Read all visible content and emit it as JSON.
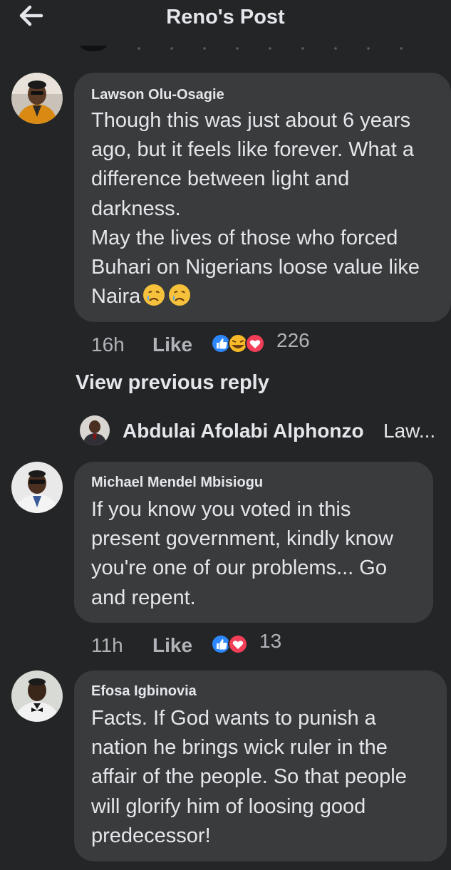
{
  "header": {
    "title": "Reno's Post",
    "back_icon": "arrow-left-icon"
  },
  "comments": [
    {
      "author": "Lawson Olu-Osagie",
      "lines": [
        "Though this was just about 6 years",
        "ago, but it feels like forever. What a",
        "difference between light and",
        "darkness.",
        "May the lives of those who forced",
        "Buhari on Nigerians loose value like",
        "Naira"
      ],
      "emoji": [
        "crying-face",
        "crying-face"
      ],
      "time": "16h",
      "like_label": "Like",
      "reactions": [
        "like",
        "haha",
        "love"
      ],
      "reaction_count": "226"
    },
    {
      "author": "Michael Mendel Mbisiogu",
      "lines": [
        "If you know you voted in this",
        "present government, kindly know",
        "you're one of our problems... Go",
        "and repent."
      ],
      "time": "11h",
      "like_label": "Like",
      "reactions": [
        "like",
        "love"
      ],
      "reaction_count": "13"
    },
    {
      "author": "Efosa Igbinovia",
      "lines": [
        "Facts. If God wants to punish a",
        "nation he brings wick ruler in the",
        "affair of the people. So that people",
        "will glorify him of loosing good",
        "predecessor!"
      ]
    }
  ],
  "replies": {
    "view_previous_label": "View previous reply",
    "preview_author": "Abdulai Afolabi Alphonzo",
    "preview_text": "Law..."
  },
  "colors": {
    "background": "#242526",
    "bubble": "#3a3b3c",
    "primary_text": "#e4e6eb",
    "secondary_text": "#b0b3b8",
    "like_blue": "#2d88ff",
    "love_red": "#f33e58",
    "haha_yellow": "#f7b928"
  }
}
